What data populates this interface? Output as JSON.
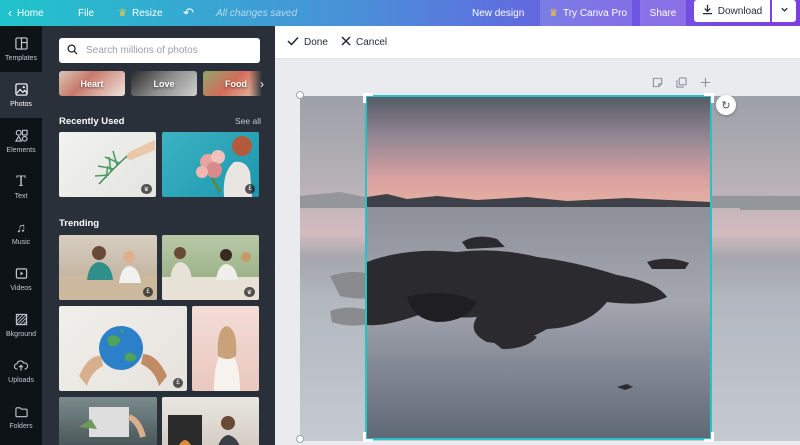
{
  "topbar": {
    "home_label": "Home",
    "file_label": "File",
    "resize_label": "Resize",
    "saved_status": "All changes saved",
    "new_design_label": "New design",
    "try_pro_label": "Try Canva Pro",
    "share_label": "Share",
    "download_label": "Download"
  },
  "rail": {
    "items": [
      {
        "label": "Templates",
        "icon": "templates-icon"
      },
      {
        "label": "Photos",
        "icon": "photos-icon"
      },
      {
        "label": "Elements",
        "icon": "elements-icon"
      },
      {
        "label": "Text",
        "icon": "text-icon"
      },
      {
        "label": "Music",
        "icon": "music-icon"
      },
      {
        "label": "Videos",
        "icon": "videos-icon"
      },
      {
        "label": "Bkground",
        "icon": "background-icon"
      },
      {
        "label": "Uploads",
        "icon": "uploads-icon"
      },
      {
        "label": "Folders",
        "icon": "folders-icon"
      }
    ],
    "active": "Photos"
  },
  "panel": {
    "search_placeholder": "Search millions of photos",
    "chips": [
      "Heart",
      "Love",
      "Food"
    ],
    "recently_used_title": "Recently Used",
    "see_all_label": "See all",
    "trending_title": "Trending",
    "badges": {
      "free": "£",
      "pro": "♛"
    }
  },
  "ctxbar": {
    "done_label": "Done",
    "cancel_label": "Cancel"
  },
  "colors": {
    "accent": "#28c2c9",
    "panel_bg": "#293039",
    "rail_bg": "#0e1318",
    "canvas_bg": "#e9ebee"
  }
}
